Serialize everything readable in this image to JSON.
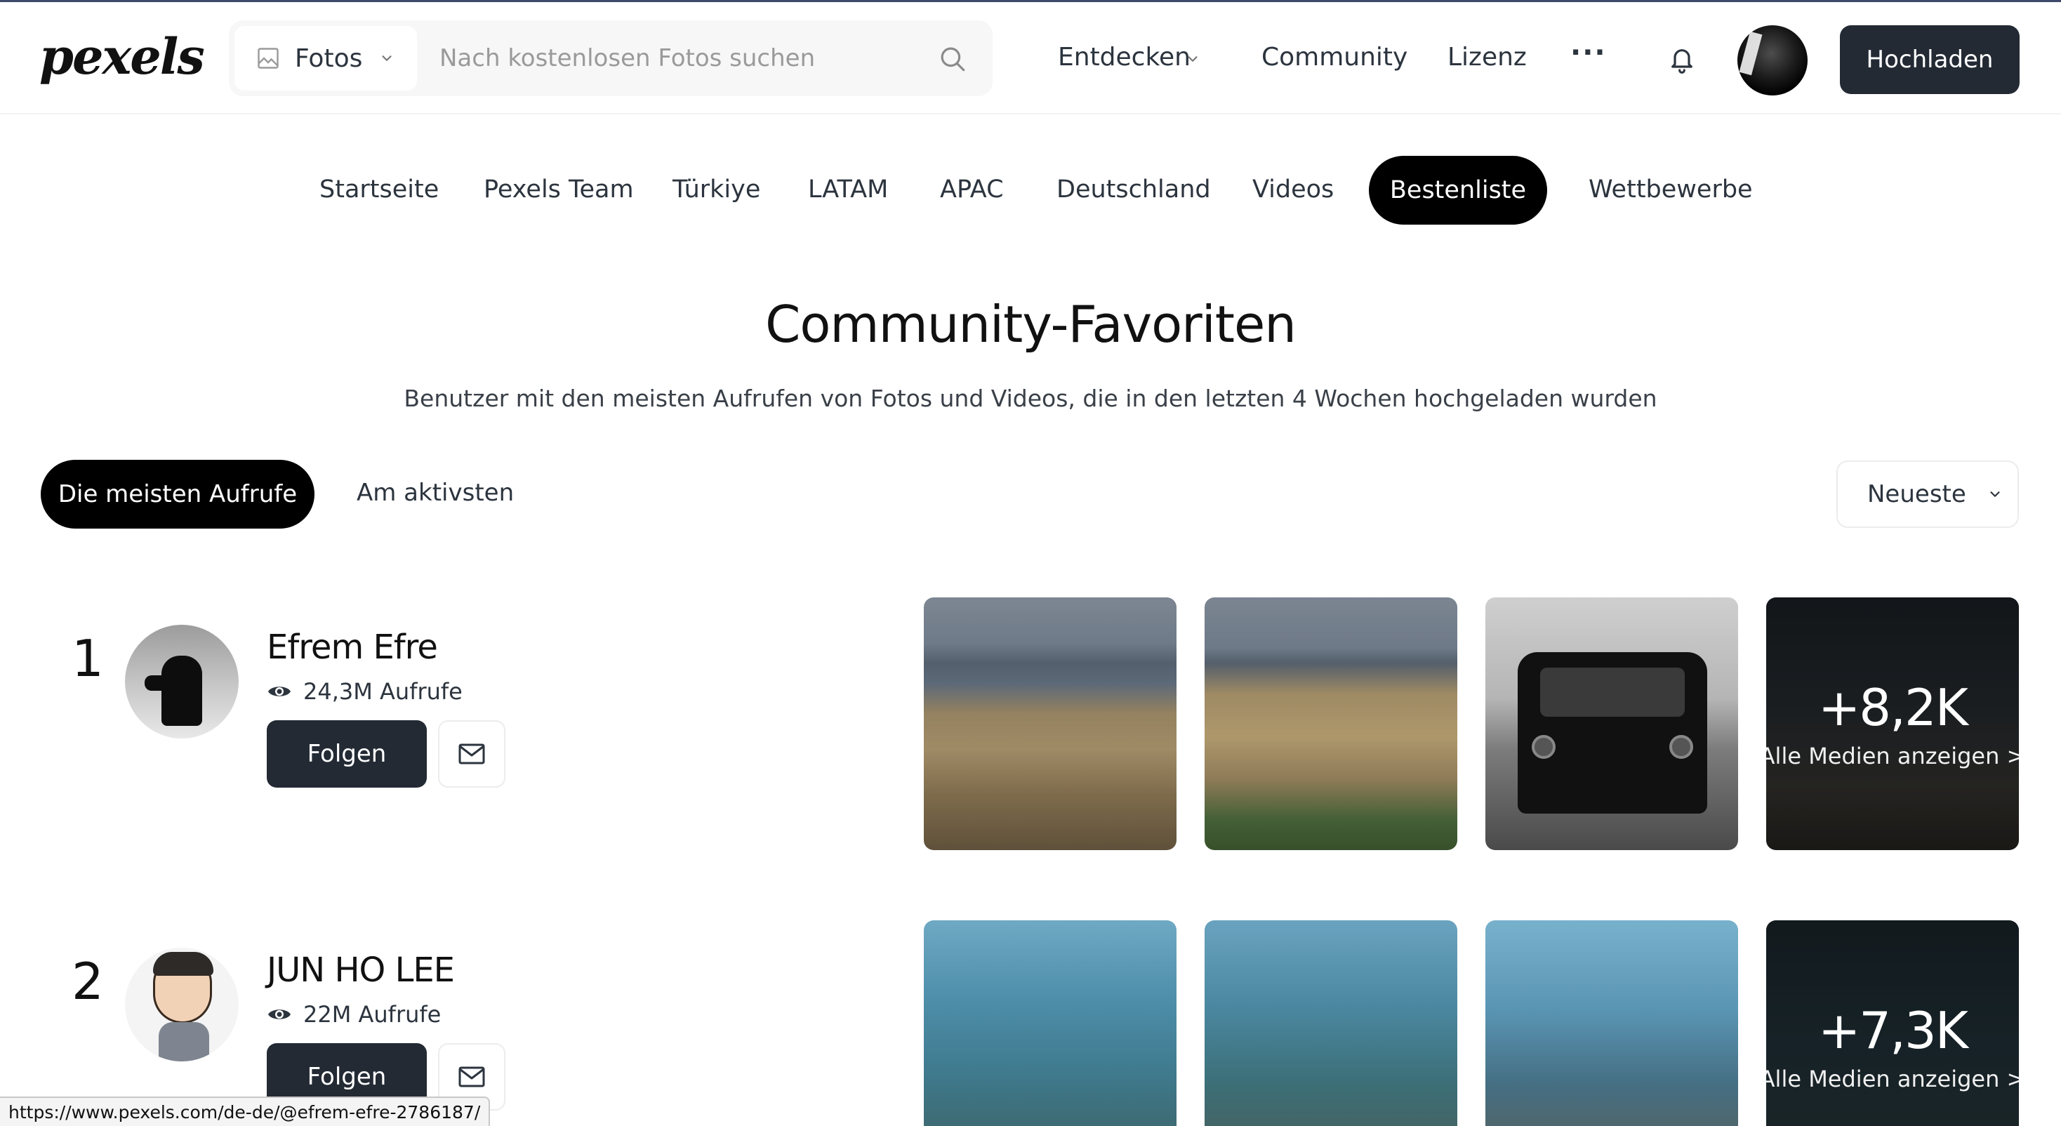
{
  "brand": {
    "logo_text": "pexels"
  },
  "search": {
    "type_label": "Fotos",
    "placeholder": "Nach kostenlosen Fotos suchen",
    "value": ""
  },
  "header": {
    "nav": [
      {
        "label": "Entdecken",
        "has_dropdown": true
      },
      {
        "label": "Community"
      },
      {
        "label": "Lizenz"
      }
    ],
    "more_label": "···",
    "upload_label": "Hochladen"
  },
  "subnav": {
    "items": [
      "Startseite",
      "Pexels Team",
      "Türkiye",
      "LATAM",
      "APAC",
      "Deutschland",
      "Videos",
      "Bestenliste",
      "Wettbewerbe"
    ],
    "active": "Bestenliste"
  },
  "page": {
    "title": "Community-Favoriten",
    "subtitle": "Benutzer mit den meisten Aufrufen von Fotos und Videos, die in den letzten 4 Wochen hochgeladen wurden"
  },
  "filters": {
    "tabs": [
      "Die meisten Aufrufe",
      "Am aktivsten"
    ],
    "active": "Die meisten Aufrufe",
    "sort_label": "Neueste"
  },
  "leaderboard": [
    {
      "rank": "1",
      "name": "Efrem Efre",
      "views": "24,3M Aufrufe",
      "follow_label": "Folgen",
      "more_count": "+8,2K",
      "more_label": "Alle Medien anzeigen >"
    },
    {
      "rank": "2",
      "name": "JUN HO LEE",
      "views": "22M Aufrufe",
      "follow_label": "Folgen",
      "more_count": "+7,3K",
      "more_label": "Alle Medien anzeigen >"
    }
  ],
  "status_bar": {
    "url": "https://www.pexels.com/de-de/@efrem-efre-2786187/"
  },
  "colors": {
    "primary_dark": "#232a34",
    "black": "#000000",
    "text": "#2c343e"
  },
  "icons": [
    "image-icon",
    "chevron-down-icon",
    "search-icon",
    "bell-icon",
    "eye-icon",
    "mail-icon"
  ]
}
